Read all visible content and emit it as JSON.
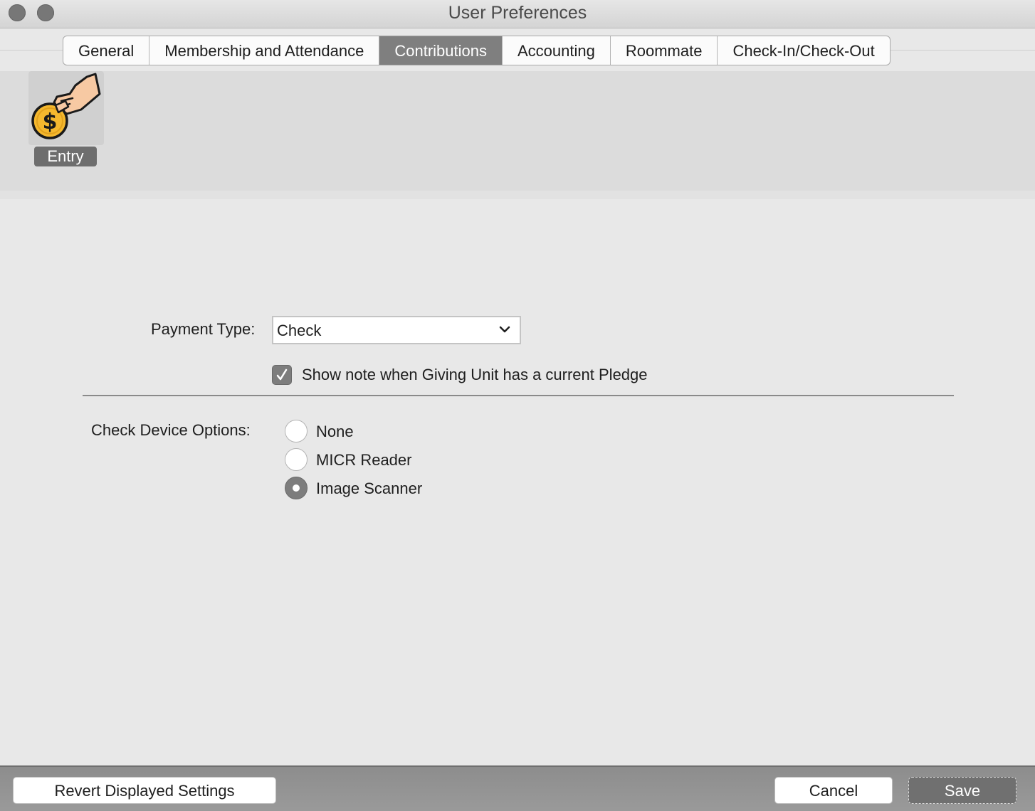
{
  "window": {
    "title": "User Preferences"
  },
  "tabs": [
    {
      "label": "General",
      "active": false
    },
    {
      "label": "Membership and Attendance",
      "active": false
    },
    {
      "label": "Contributions",
      "active": true
    },
    {
      "label": "Accounting",
      "active": false
    },
    {
      "label": "Roommate",
      "active": false
    },
    {
      "label": "Check-In/Check-Out",
      "active": false
    }
  ],
  "toolbar": {
    "entry": {
      "label": "Entry",
      "icon": "hand-coin-icon",
      "selected": true
    }
  },
  "form": {
    "payment_type": {
      "label": "Payment Type:",
      "value": "Check"
    },
    "pledge_note": {
      "label": "Show note when Giving Unit has a current Pledge",
      "checked": true
    },
    "check_device": {
      "label": "Check Device Options:",
      "options": [
        {
          "label": "None",
          "selected": false
        },
        {
          "label": "MICR Reader",
          "selected": false
        },
        {
          "label": "Image Scanner",
          "selected": true
        }
      ]
    }
  },
  "footer": {
    "revert_label": "Revert Displayed Settings",
    "cancel_label": "Cancel",
    "save_label": "Save"
  },
  "colors": {
    "accent_gray": "#7f7f7f",
    "coin_yellow": "#f5b82e",
    "hand_skin": "#f7c9a3"
  }
}
